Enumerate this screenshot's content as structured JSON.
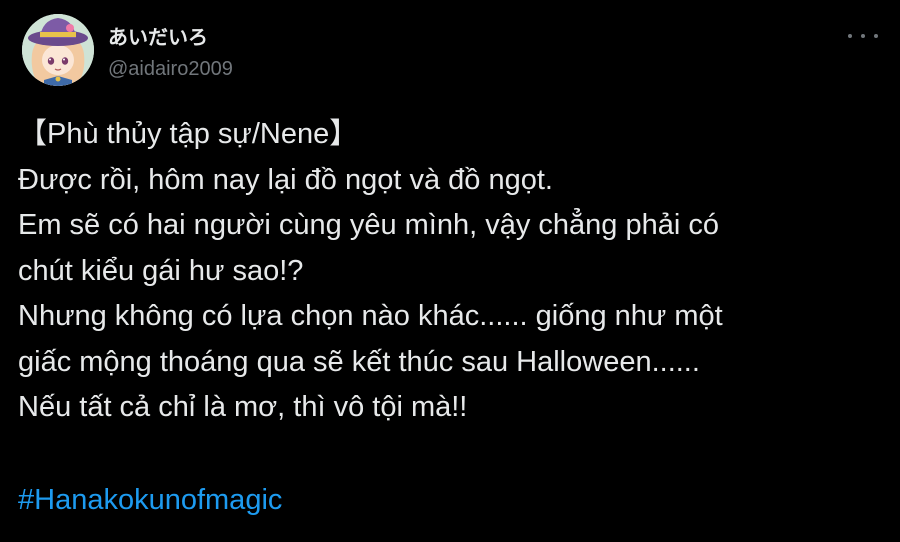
{
  "author": {
    "display_name": "あいだいろ",
    "handle": "@aidairo2009",
    "avatar": "avatar-anime-girl-witch-hat"
  },
  "menu": {
    "icon": "more-horizontal-icon"
  },
  "tweet": {
    "lines": [
      "【Phù thủy tập sự/Nene】",
      "Được rồi, hôm nay lại đồ ngọt và đồ ngọt.",
      "Em sẽ có hai người cùng yêu mình, vậy chẳng phải có",
      "chút kiểu gái hư sao!?",
      "Nhưng không có lựa chọn nào khác...... giống như một",
      "giấc mộng thoáng qua sẽ kết thúc sau Halloween......",
      "Nếu tất cả chỉ là mơ, thì vô tội mà!!"
    ],
    "hashtag": "#Hanakokunofmagic"
  },
  "colors": {
    "background": "#000000",
    "text": "#e7e9ea",
    "secondary": "#71767b",
    "link": "#1d9bf0"
  }
}
